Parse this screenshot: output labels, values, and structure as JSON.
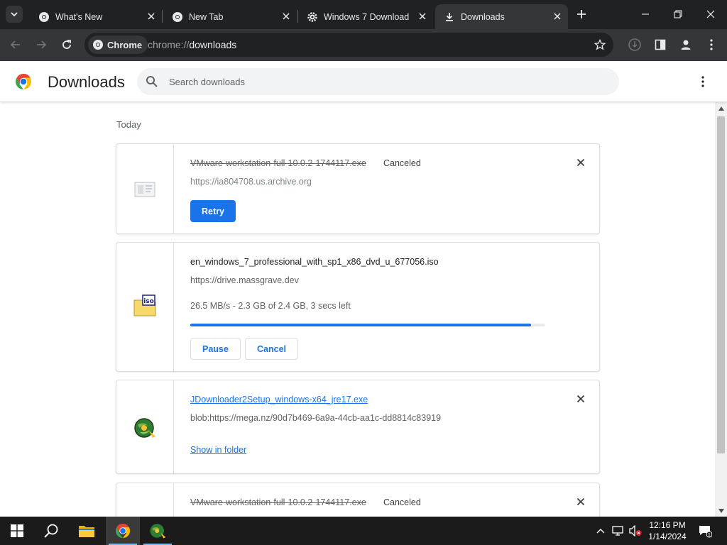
{
  "tabs": [
    {
      "title": "What's New",
      "icon": "chrome-icon",
      "active": false
    },
    {
      "title": "New Tab",
      "icon": "chrome-icon",
      "active": false
    },
    {
      "title": "Windows 7 Download",
      "icon": "gear-icon",
      "active": false
    },
    {
      "title": "Downloads",
      "icon": "download-icon",
      "active": true
    }
  ],
  "toolbar": {
    "chip_label": "Chrome",
    "url_scheme": "chrome://",
    "url_path": "downloads"
  },
  "page": {
    "title": "Downloads",
    "search_placeholder": "Search downloads",
    "section_title": "Today"
  },
  "downloads": [
    {
      "filename": "VMware-workstation-full-10.0.2-1744117.exe",
      "status": "Canceled",
      "url": "https://ia804708.us.archive.org",
      "action": "Retry",
      "icon": "generic-file-icon"
    },
    {
      "filename": "en_windows_7_professional_with_sp1_x86_dvd_u_677056.iso",
      "url": "https://drive.massgrave.dev",
      "progress_text": "26.5 MB/s - 2.3 GB of 2.4 GB, 3 secs left",
      "progress_fraction": 0.96,
      "pause_label": "Pause",
      "cancel_label": "Cancel",
      "icon": "iso-file-icon"
    },
    {
      "filename": "JDownloader2Setup_windows-x64_jre17.exe",
      "url": "blob:https://mega.nz/90d7b469-6a9a-44cb-aa1c-dd8814c83919",
      "action": "Show in folder",
      "icon": "jdownloader-icon"
    },
    {
      "filename": "VMware-workstation-full-10.0.2-1744117.exe",
      "status": "Canceled",
      "icon": "generic-file-icon"
    }
  ],
  "taskbar": {
    "time": "12:16 PM",
    "date": "1/14/2024",
    "notification_count": "1"
  },
  "colors": {
    "accent": "#1a73e8",
    "tabstrip_bg": "#202124",
    "toolbar_bg": "#35363a"
  }
}
